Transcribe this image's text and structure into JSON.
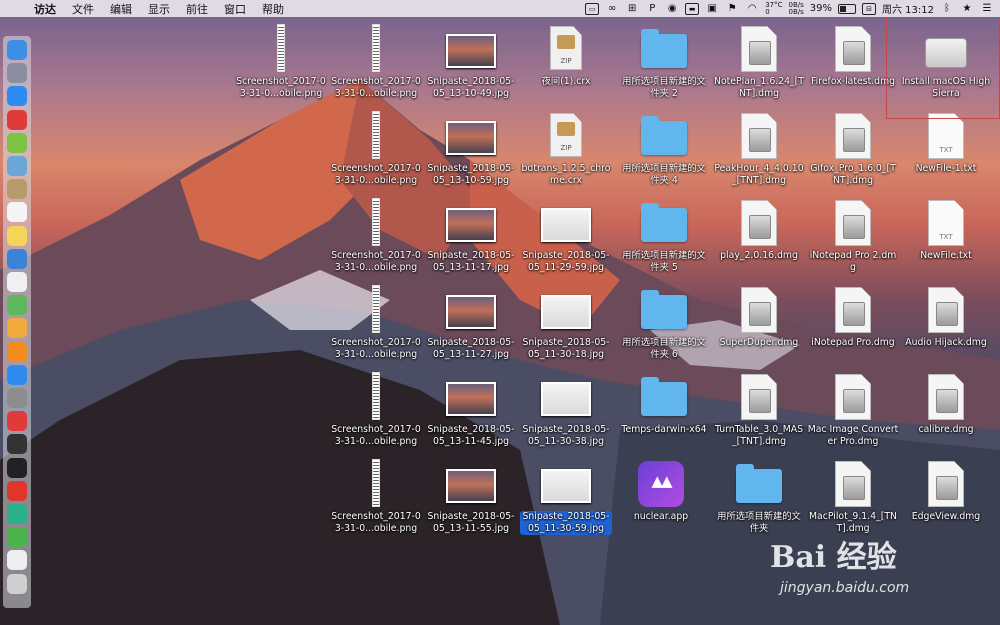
{
  "menubar": {
    "app": "访达",
    "menus": [
      "文件",
      "编辑",
      "显示",
      "前往",
      "窗口",
      "帮助"
    ],
    "temp": "37°C",
    "temp_sub": "0",
    "net_up": "0B/s",
    "net_down": "0B/s",
    "battery": "39%",
    "datetime": "周六 13:12"
  },
  "icons": [
    {
      "type": "screenshot",
      "label": "Screenshot_2017-03-31-0...obile.png"
    },
    {
      "type": "screenshot",
      "label": "Screenshot_2017-03-31-0...obile.png"
    },
    {
      "type": "snip",
      "label": "Snipaste_2018-05-05_13-10-49.jpg"
    },
    {
      "type": "zip",
      "label": "夜间(1).crx"
    },
    {
      "type": "folder",
      "label": "用所选项目新建的文件夹 2"
    },
    {
      "type": "dmg",
      "label": "NotePlan_1.6.24_[TNT].dmg"
    },
    {
      "type": "dmg",
      "label": "Firefox-latest.dmg"
    },
    {
      "type": "drive",
      "label": "Install macOS High Sierra"
    },
    {
      "type": "screenshot",
      "label": "Screenshot_2017-03-31-0...obile.png"
    },
    {
      "type": "snip",
      "label": "Snipaste_2018-05-05_13-10-59.jpg"
    },
    {
      "type": "zip",
      "label": "bdtrans_1.2.5_chrome.crx"
    },
    {
      "type": "folder",
      "label": "用所选项目新建的文件夹 4"
    },
    {
      "type": "dmg",
      "label": "PeakHour_4_4.0.10_[TNT].dmg"
    },
    {
      "type": "dmg",
      "label": "Gifox_Pro_1.6.0_[TNT].dmg"
    },
    {
      "type": "txt",
      "label": "NewFile-1.txt",
      "tag": "TXT"
    },
    {
      "type": "screenshot",
      "label": "Screenshot_2017-03-31-0...obile.png"
    },
    {
      "type": "snip",
      "label": "Snipaste_2018-05-05_13-11-17.jpg"
    },
    {
      "type": "snip-white",
      "label": "Snipaste_2018-05-05_11-29-59.jpg"
    },
    {
      "type": "folder",
      "label": "用所选项目新建的文件夹 5"
    },
    {
      "type": "dmg",
      "label": "play_2.0.16.dmg"
    },
    {
      "type": "dmg",
      "label": "iNotepad Pro 2.dmg"
    },
    {
      "type": "txt",
      "label": "NewFile.txt",
      "tag": "TXT"
    },
    {
      "type": "screenshot",
      "label": "Screenshot_2017-03-31-0...obile.png"
    },
    {
      "type": "snip",
      "label": "Snipaste_2018-05-05_13-11-27.jpg"
    },
    {
      "type": "snip-white",
      "label": "Snipaste_2018-05-05_11-30-18.jpg"
    },
    {
      "type": "folder",
      "label": "用所选项目新建的文件夹 6"
    },
    {
      "type": "dmg",
      "label": "SuperDuper.dmg"
    },
    {
      "type": "dmg",
      "label": "iNotepad Pro.dmg"
    },
    {
      "type": "dmg",
      "label": "Audio Hijack.dmg"
    },
    {
      "type": "screenshot",
      "label": "Screenshot_2017-03-31-0...obile.png"
    },
    {
      "type": "snip",
      "label": "Snipaste_2018-05-05_13-11-45.jpg"
    },
    {
      "type": "snip-white",
      "label": "Snipaste_2018-05-05_11-30-38.jpg"
    },
    {
      "type": "folder",
      "label": "Temps-darwin-x64"
    },
    {
      "type": "dmg",
      "label": "TurnTable_3.0_MAS_[TNT].dmg"
    },
    {
      "type": "dmg",
      "label": "Mac Image Converter Pro.dmg"
    },
    {
      "type": "dmg",
      "label": "calibre.dmg"
    },
    {
      "type": "screenshot",
      "label": "Screenshot_2017-03-31-0...obile.png"
    },
    {
      "type": "snip",
      "label": "Snipaste_2018-05-05_13-11-55.jpg"
    },
    {
      "type": "snip-white",
      "label": "Snipaste_2018-05-05_11-30-59.jpg",
      "selected": true
    },
    {
      "type": "app",
      "label": "nuclear.app"
    },
    {
      "type": "folder",
      "label": "用所选项目新建的文件夹"
    },
    {
      "type": "dmg",
      "label": "MacPilot_9.1.4_[TNT].dmg"
    },
    {
      "type": "dmg",
      "label": "EdgeView.dmg"
    }
  ],
  "dock": [
    {
      "icon": "finder-icon",
      "color": "#3d8fe6"
    },
    {
      "icon": "launchpad-icon",
      "color": "#8a8fa0"
    },
    {
      "icon": "safari-icon",
      "color": "#2e8bf0"
    },
    {
      "icon": "app-red-icon",
      "color": "#e03a3a"
    },
    {
      "icon": "android-icon",
      "color": "#7cc243"
    },
    {
      "icon": "preview-icon",
      "color": "#6aa7d8"
    },
    {
      "icon": "notes-brown-icon",
      "color": "#b89b6d"
    },
    {
      "icon": "calendar-icon",
      "color": "#f4f4f4"
    },
    {
      "icon": "notes-icon",
      "color": "#f6d35b"
    },
    {
      "icon": "search-icon",
      "color": "#3b82d9"
    },
    {
      "icon": "textedit-icon",
      "color": "#f0f0f0"
    },
    {
      "icon": "maps-icon",
      "color": "#5cb85c"
    },
    {
      "icon": "photos-icon",
      "color": "#f2a93b"
    },
    {
      "icon": "books-icon",
      "color": "#f28c1e"
    },
    {
      "icon": "appstore-icon",
      "color": "#2e8bf0"
    },
    {
      "icon": "settings-icon",
      "color": "#8d8d8d"
    },
    {
      "icon": "vivaldi-icon",
      "color": "#e03a3a"
    },
    {
      "icon": "activity-monitor-icon",
      "color": "#333333"
    },
    {
      "icon": "terminal-icon",
      "color": "#222222"
    },
    {
      "icon": "weibo-icon",
      "color": "#e0352b"
    },
    {
      "icon": "chat-icon",
      "color": "#2ab08a"
    },
    {
      "icon": "wechat-icon",
      "color": "#48b44a"
    },
    {
      "icon": "document-icon",
      "color": "#eeeeee"
    },
    {
      "icon": "trash-icon",
      "color": "#cfcfcf"
    }
  ],
  "watermark": {
    "logo": "Bai 经验",
    "url": "jingyan.baidu.com"
  }
}
